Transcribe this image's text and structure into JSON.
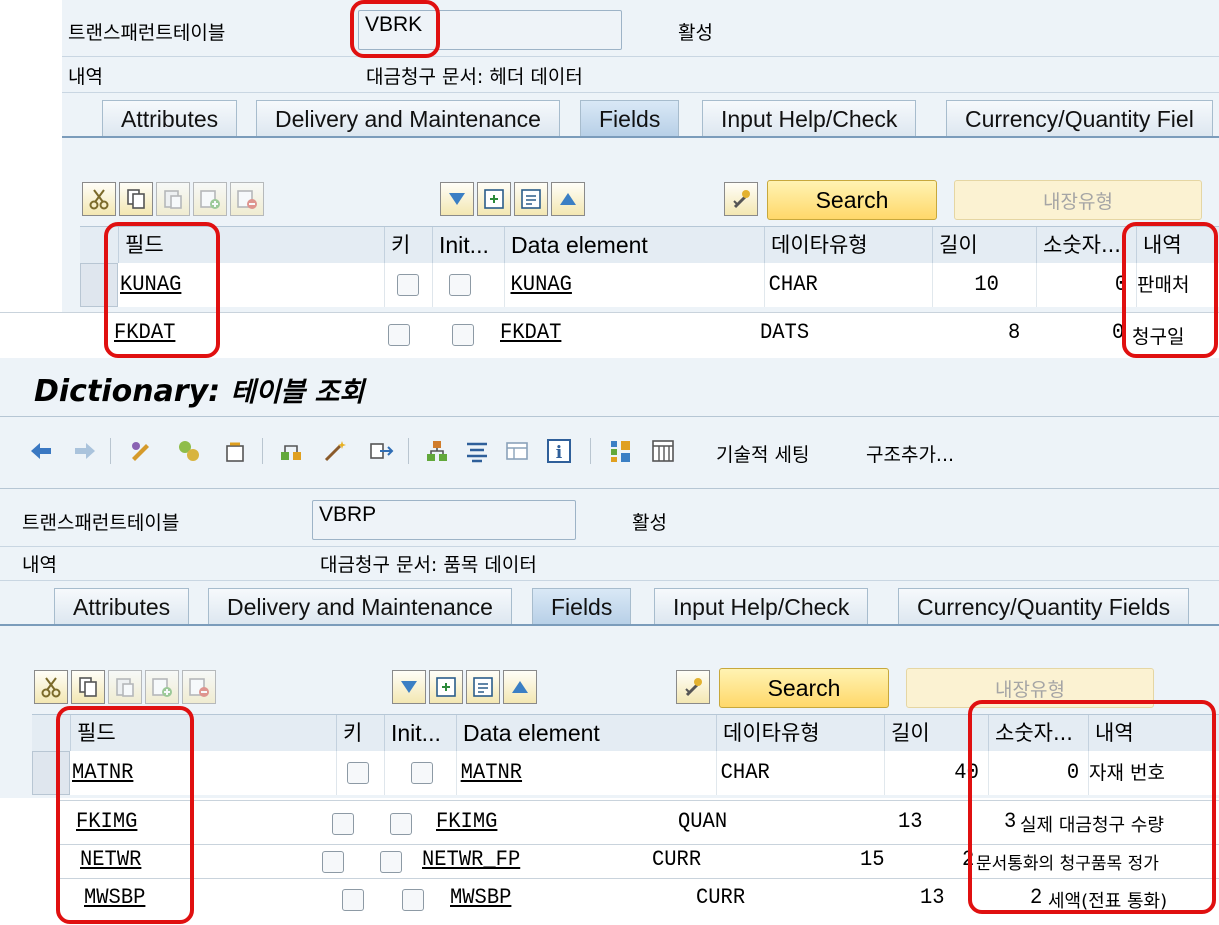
{
  "vbrk": {
    "table_label": "트랜스패런트테이블",
    "table_name": "VBRK",
    "status": "활성",
    "desc_label": "내역",
    "desc": "대금청구 문서: 헤더 데이터",
    "tabs": [
      "Attributes",
      "Delivery and Maintenance",
      "Fields",
      "Input Help/Check",
      "Currency/Quantity Fiel"
    ],
    "search_label": "Search",
    "builtin_label": "내장유형",
    "columns": [
      "필드",
      "키",
      "Init...",
      "Data element",
      "데이타유형",
      "길이",
      "소숫자...",
      "내역"
    ],
    "rows": [
      {
        "field": "KUNAG",
        "element": "KUNAG",
        "type": "CHAR",
        "length": "10",
        "decimals": "0",
        "desc": "판매처"
      },
      {
        "field": "FKDAT",
        "element": "FKDAT",
        "type": "DATS",
        "length": "8",
        "decimals": "0",
        "desc": "청구일"
      }
    ]
  },
  "vbrp": {
    "window_title_bold": "Dictionary:",
    "window_title_rest": "테이블 조회",
    "tech_settings": "기술적 세팅",
    "append_structure": "구조추가...",
    "table_label": "트랜스패런트테이블",
    "table_name": "VBRP",
    "status": "활성",
    "desc_label": "내역",
    "desc": "대금청구 문서: 품목 데이터",
    "tabs": [
      "Attributes",
      "Delivery and Maintenance",
      "Fields",
      "Input Help/Check",
      "Currency/Quantity Fields"
    ],
    "search_label": "Search",
    "builtin_label": "내장유형",
    "columns": [
      "필드",
      "키",
      "Init...",
      "Data element",
      "데이타유형",
      "길이",
      "소숫자...",
      "내역"
    ],
    "rows": [
      {
        "field": "MATNR",
        "element": "MATNR",
        "type": "CHAR",
        "length": "40",
        "decimals": "0",
        "desc": "자재 번호"
      },
      {
        "field": "FKIMG",
        "element": "FKIMG",
        "type": "QUAN",
        "length": "13",
        "decimals": "3",
        "desc": "실제 대금청구 수량"
      },
      {
        "field": "NETWR",
        "element": "NETWR_FP",
        "type": "CURR",
        "length": "15",
        "decimals": "2",
        "desc": "문서통화의 청구품목 정가"
      },
      {
        "field": "MWSBP",
        "element": "MWSBP",
        "type": "CURR",
        "length": "13",
        "decimals": "2",
        "desc": "세액(전표 통화)"
      }
    ]
  },
  "colors": {
    "highlight": "#e01010",
    "search_button": "#ffd86a",
    "tab_active": "#b8d0e7"
  }
}
